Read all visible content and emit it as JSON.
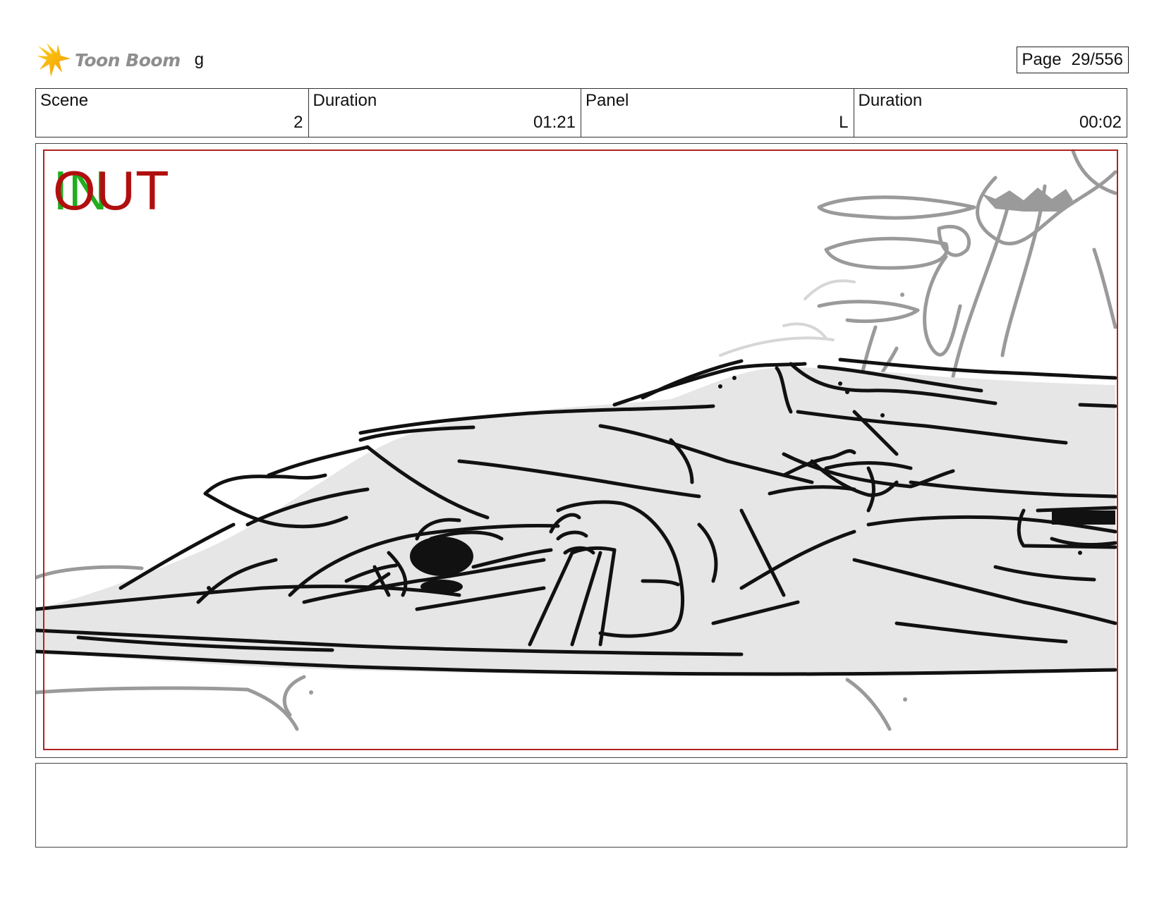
{
  "header": {
    "brand": "Toon Boom",
    "logo_icon": "toon-boom-burst-icon",
    "project_name": "g",
    "page_label": "Page",
    "page_value": "29/556"
  },
  "info_bar": [
    {
      "label": "Scene",
      "value": "2"
    },
    {
      "label": "Duration",
      "value": "01:21"
    },
    {
      "label": "Panel",
      "value": "L"
    },
    {
      "label": "Duration",
      "value": "00:02"
    }
  ],
  "panel": {
    "in_label": "IN",
    "out_label": "OUT",
    "in_color": "#1fae1f",
    "out_color": "#b10f0f",
    "safe_frame_color": "#b22222"
  },
  "notes": {
    "text": ""
  }
}
